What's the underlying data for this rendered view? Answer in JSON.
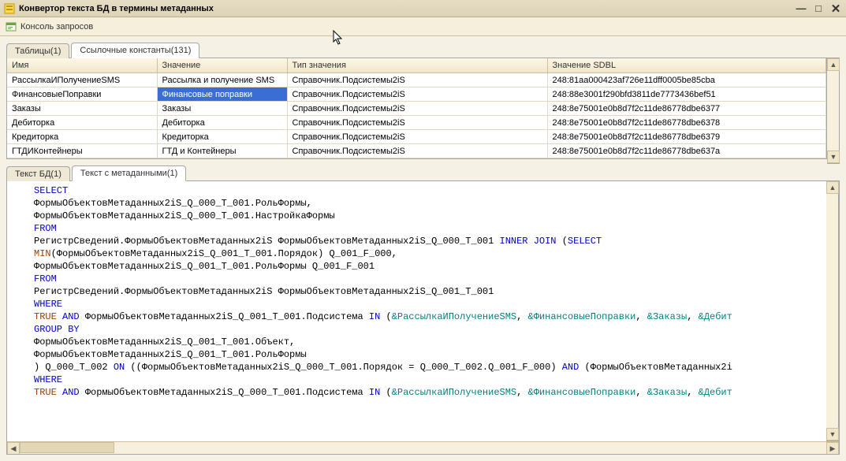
{
  "window": {
    "title": "Конвертор текста БД в термины метаданных"
  },
  "toolbar": {
    "console_label": "Консоль запросов"
  },
  "upper_tabs": {
    "tab_tables": "Таблицы(1)",
    "tab_refs": "Ссылочные константы(131)"
  },
  "grid": {
    "headers": {
      "name": "Имя",
      "value": "Значение",
      "value_type": "Тип значения",
      "value_sdbl": "Значение SDBL"
    },
    "rows": [
      {
        "name": "РассылкаИПолучениеSMS",
        "value": "Рассылка и получение SMS",
        "type": "Справочник.Подсистемы2iS",
        "sdbl": "248:81aa000423af726e11dff0005be85cba"
      },
      {
        "name": "ФинансовыеПоправки",
        "value": "Финансовые поправки",
        "type": "Справочник.Подсистемы2iS",
        "sdbl": "248:88e3001f290bfd3811de7773436bef51"
      },
      {
        "name": "Заказы",
        "value": "Заказы",
        "type": "Справочник.Подсистемы2iS",
        "sdbl": "248:8e75001e0b8d7f2c11de86778dbe6377"
      },
      {
        "name": "Дебиторка",
        "value": "Дебиторка",
        "type": "Справочник.Подсистемы2iS",
        "sdbl": "248:8e75001e0b8d7f2c11de86778dbe6378"
      },
      {
        "name": "Кредиторка",
        "value": "Кредиторка",
        "type": "Справочник.Подсистемы2iS",
        "sdbl": "248:8e75001e0b8d7f2c11de86778dbe6379"
      },
      {
        "name": "ГТДИКонтейнеры",
        "value": "ГТД и Контейнеры",
        "type": "Справочник.Подсистемы2iS",
        "sdbl": "248:8e75001e0b8d7f2c11de86778dbe637a"
      }
    ],
    "selected_row_index": 1,
    "selected_col": "value"
  },
  "lower_tabs": {
    "tab_db": "Текст БД(1)",
    "tab_meta": "Текст с метаданными(1)"
  },
  "code": {
    "lines": [
      [
        {
          "t": "SELECT",
          "c": "kw"
        }
      ],
      [
        {
          "t": "ФормыОбъектовМетаданных2iS_Q_000_T_001.РольФормы,",
          "c": ""
        }
      ],
      [
        {
          "t": "ФормыОбъектовМетаданных2iS_Q_000_T_001.НастройкаФормы",
          "c": ""
        }
      ],
      [
        {
          "t": "FROM",
          "c": "kw"
        }
      ],
      [
        {
          "t": "РегистрСведений.ФормыОбъектовМетаданных2iS ФормыОбъектовМетаданных2iS_Q_000_T_001 ",
          "c": ""
        },
        {
          "t": "INNER JOIN",
          "c": "kw"
        },
        {
          "t": " (",
          "c": ""
        },
        {
          "t": "SELECT",
          "c": "kw"
        }
      ],
      [
        {
          "t": "MIN",
          "c": "fn"
        },
        {
          "t": "(ФормыОбъектовМетаданных2iS_Q_001_T_001.Порядок) Q_001_F_000,",
          "c": ""
        }
      ],
      [
        {
          "t": "ФормыОбъектовМетаданных2iS_Q_001_T_001.РольФормы Q_001_F_001",
          "c": ""
        }
      ],
      [
        {
          "t": "FROM",
          "c": "kw"
        }
      ],
      [
        {
          "t": "РегистрСведений.ФормыОбъектовМетаданных2iS ФормыОбъектовМетаданных2iS_Q_001_T_001",
          "c": ""
        }
      ],
      [
        {
          "t": "WHERE",
          "c": "kw"
        }
      ],
      [
        {
          "t": "TRUE",
          "c": "bool"
        },
        {
          "t": " ",
          "c": ""
        },
        {
          "t": "AND",
          "c": "kw"
        },
        {
          "t": " ФормыОбъектовМетаданных2iS_Q_001_T_001.Подсистема ",
          "c": ""
        },
        {
          "t": "IN",
          "c": "kw"
        },
        {
          "t": " (",
          "c": ""
        },
        {
          "t": "&РассылкаИПолучениеSMS",
          "c": "ref"
        },
        {
          "t": ", ",
          "c": ""
        },
        {
          "t": "&ФинансовыеПоправки",
          "c": "ref"
        },
        {
          "t": ", ",
          "c": ""
        },
        {
          "t": "&Заказы",
          "c": "ref"
        },
        {
          "t": ", ",
          "c": ""
        },
        {
          "t": "&Дебит",
          "c": "ref"
        }
      ],
      [
        {
          "t": "GROUP BY",
          "c": "kw"
        }
      ],
      [
        {
          "t": "ФормыОбъектовМетаданных2iS_Q_001_T_001.Объект,",
          "c": ""
        }
      ],
      [
        {
          "t": "ФормыОбъектовМетаданных2iS_Q_001_T_001.РольФормы",
          "c": ""
        }
      ],
      [
        {
          "t": ") Q_000_T_002 ",
          "c": ""
        },
        {
          "t": "ON",
          "c": "kw"
        },
        {
          "t": " ((ФормыОбъектовМетаданных2iS_Q_000_T_001.Порядок = Q_000_T_002.Q_001_F_000) ",
          "c": ""
        },
        {
          "t": "AND",
          "c": "kw"
        },
        {
          "t": " (ФормыОбъектовМетаданных2i",
          "c": ""
        }
      ],
      [
        {
          "t": "WHERE",
          "c": "kw"
        }
      ],
      [
        {
          "t": "TRUE",
          "c": "bool"
        },
        {
          "t": " ",
          "c": ""
        },
        {
          "t": "AND",
          "c": "kw"
        },
        {
          "t": " ФормыОбъектовМетаданных2iS_Q_000_T_001.Подсистема ",
          "c": ""
        },
        {
          "t": "IN",
          "c": "kw"
        },
        {
          "t": " (",
          "c": ""
        },
        {
          "t": "&РассылкаИПолучениеSMS",
          "c": "ref"
        },
        {
          "t": ", ",
          "c": ""
        },
        {
          "t": "&ФинансовыеПоправки",
          "c": "ref"
        },
        {
          "t": ", ",
          "c": ""
        },
        {
          "t": "&Заказы",
          "c": "ref"
        },
        {
          "t": ", ",
          "c": ""
        },
        {
          "t": "&Дебит",
          "c": "ref"
        }
      ]
    ]
  }
}
